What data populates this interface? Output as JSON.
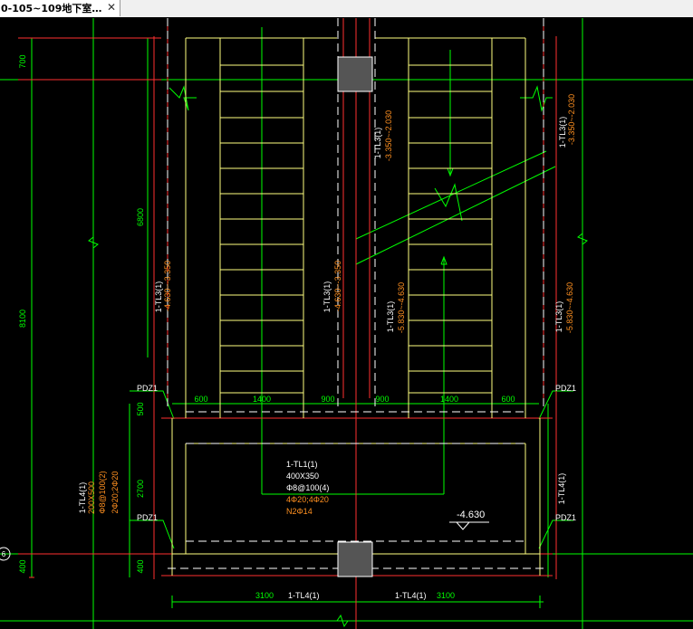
{
  "tab": {
    "title": "0-105~109地下室…",
    "close_icon": "close-icon"
  },
  "colors": {
    "background": "#000000",
    "yellow": "#ffff80",
    "green": "#00ff00",
    "red": "#ff3030",
    "white": "#ffffff",
    "orange": "#ff9020",
    "column": "#555555"
  },
  "drawing": {
    "dims": {
      "top_700": "700",
      "mid_6800": "6800",
      "total_8100": "8100",
      "bay_500": "500",
      "bay_2700": "2700",
      "bay_400": "400",
      "seg_600_l": "600",
      "seg_1400_l": "1400",
      "seg_900_l": "900",
      "seg_900_r": "900",
      "seg_1400_r": "1400",
      "seg_600_r": "600",
      "bottom_3100_l": "3100",
      "bottom_3100_r": "3100"
    },
    "labels": {
      "pdz1_ul": "PDZ1",
      "pdz1_ur": "PDZ1",
      "pdz1_ll": "PDZ1",
      "pdz1_lr": "PDZ1",
      "tl3_top_mid_name": "1-TL3(1)",
      "tl3_top_mid_elev": "-3.350~-2.030",
      "tl3_top_right_name": "1-TL3(1)",
      "tl3_top_right_elev": "-3.350~-2.030",
      "tl3_left_name": "1-TL3(1)",
      "tl3_left_elev": "-4.630~-3.350",
      "tl3_cmid_name": "1-TL3(1)",
      "tl3_cmid_elev": "-4.630~-3.350",
      "tl3_rmid_name": "1-TL3(1)",
      "tl3_rmid_elev": "-5.830~-4.630",
      "tl3_rfar_name": "1-TL3(1)",
      "tl3_rfar_elev": "-5.830~-4.630",
      "tl1_name": "1-TL1(1)",
      "tl1_size": "400X350",
      "tl1_stirrup": "Φ8@100(4)",
      "tl1_top": "4Φ20;4Φ20",
      "tl1_side": "N2Φ14",
      "tl4_left_name": "1-TL4(1)",
      "tl4_left_size": "200X500",
      "tl4_left_stirrup": "Φ8@100(2)",
      "tl4_left_rebar": "2Φ20;2Φ20",
      "tl4_right_name": "1-TL4(1)",
      "tl4_bottom_l": "1-TL4(1)",
      "tl4_bottom_r": "1-TL4(1)",
      "elevation": "-4.630",
      "axis_marker": "6"
    }
  }
}
